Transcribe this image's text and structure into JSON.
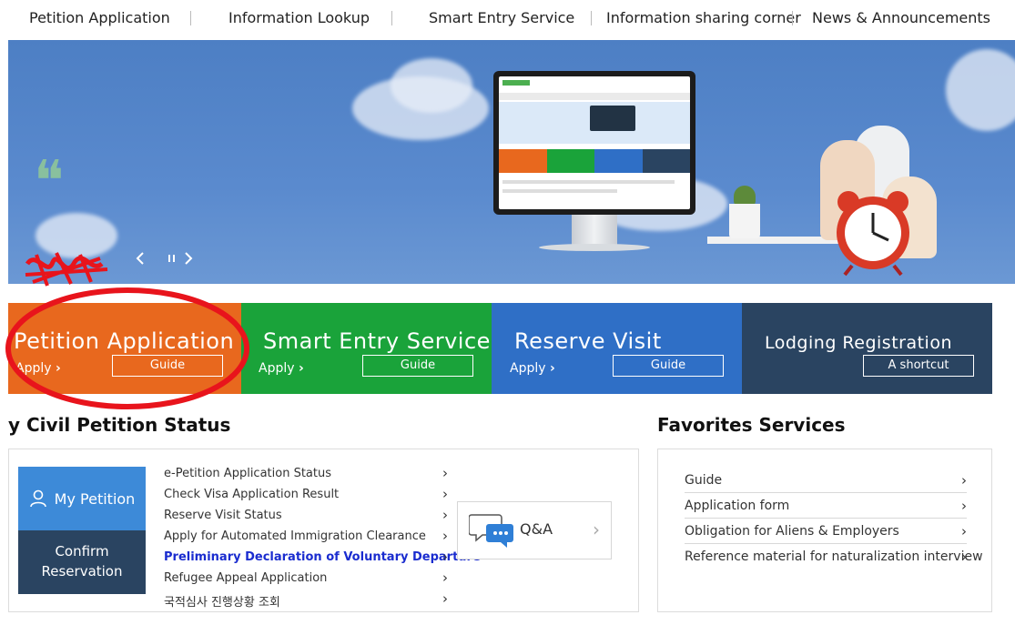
{
  "topnav": {
    "items": [
      {
        "label": "Petition Application"
      },
      {
        "label": "Information Lookup"
      },
      {
        "label": "Smart Entry Service"
      },
      {
        "label": "Information sharing corner"
      },
      {
        "label": "News & Announcements"
      }
    ]
  },
  "banner": {
    "quote_glyph": "❝",
    "prev_icon": "chevron-left-icon",
    "pause_icon": "pause-icon",
    "next_icon": "chevron-right-icon"
  },
  "tiles": [
    {
      "title": "Petition Application",
      "apply": "Apply",
      "button": "Guide",
      "color": "#e8681e"
    },
    {
      "title": "Smart Entry Service",
      "apply": "Apply",
      "button": "Guide",
      "color": "#1aa33a"
    },
    {
      "title": "Reserve Visit",
      "apply": "Apply",
      "button": "Guide",
      "color": "#2f6fc6"
    },
    {
      "title": "Lodging Registration",
      "apply": "",
      "button": "A shortcut",
      "color": "#2a4461"
    }
  ],
  "petition_status": {
    "title": "y Civil Petition Status",
    "my_petition": "My Petition",
    "confirm_line1": "Confirm",
    "confirm_line2": "Reservation",
    "items": [
      {
        "label": "e-Petition Application Status"
      },
      {
        "label": "Check Visa Application Result"
      },
      {
        "label": "Reserve Visit Status"
      },
      {
        "label": "Apply for Automated Immigration Clearance"
      },
      {
        "label": "Preliminary Declaration of Voluntary Departure"
      },
      {
        "label": "Refugee Appeal Application"
      },
      {
        "label": "국적심사 진행상황 조회"
      }
    ],
    "qa_label": "Q&A"
  },
  "favorites": {
    "title": "Favorites Services",
    "items": [
      {
        "label": "Guide"
      },
      {
        "label": "Application form"
      },
      {
        "label": "Obligation for Aliens & Employers"
      },
      {
        "label": "Reference material for naturalization interview"
      }
    ]
  },
  "colors": {
    "accent_blue": "#3d8ad8",
    "navy": "#2a4461",
    "highlight_link": "#1a2ccf",
    "annotation_red": "#e8141c"
  }
}
